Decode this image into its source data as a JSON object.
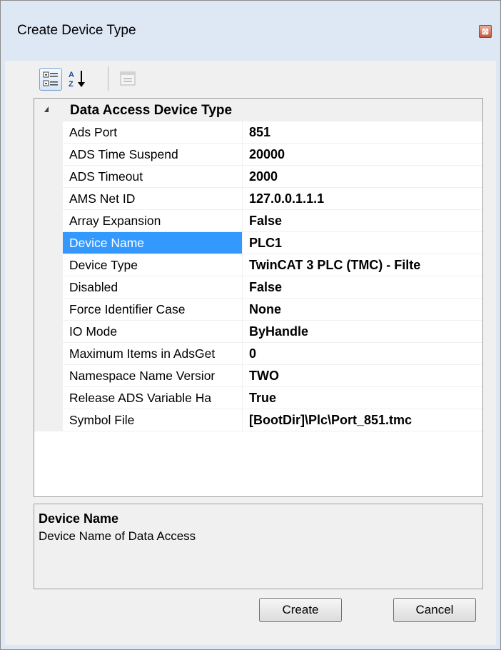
{
  "window": {
    "title": "Create Device Type",
    "close_glyph": "⊠"
  },
  "toolbar": {
    "categorized_icon": "categorized-view-icon",
    "alphabetical_icon": "sort-alphabetical-icon",
    "property_pages_icon": "property-pages-icon"
  },
  "grid": {
    "category": "Data Access Device Type",
    "properties": [
      {
        "name": "Ads Port",
        "value": "851"
      },
      {
        "name": "ADS Time Suspend",
        "value": "20000"
      },
      {
        "name": "ADS Timeout",
        "value": "2000"
      },
      {
        "name": "AMS Net ID",
        "value": "127.0.0.1.1.1"
      },
      {
        "name": "Array Expansion",
        "value": "False"
      },
      {
        "name": "Device Name",
        "value": "PLC1",
        "selected": true
      },
      {
        "name": "Device Type",
        "value": "TwinCAT 3 PLC (TMC) - Filte"
      },
      {
        "name": "Disabled",
        "value": "False"
      },
      {
        "name": "Force Identifier Case",
        "value": "None"
      },
      {
        "name": "IO Mode",
        "value": "ByHandle"
      },
      {
        "name": "Maximum Items in AdsGet",
        "value": "0"
      },
      {
        "name": "Namespace Name Versior",
        "value": "TWO"
      },
      {
        "name": "Release ADS Variable Ha",
        "value": "True"
      },
      {
        "name": "Symbol File",
        "value": "[BootDir]\\Plc\\Port_851.tmc"
      }
    ]
  },
  "description": {
    "title": "Device Name",
    "text": "Device Name of Data Access"
  },
  "buttons": {
    "create": "Create",
    "cancel": "Cancel"
  },
  "colors": {
    "selection": "#3399ff",
    "window_frame": "#dde8f4"
  }
}
